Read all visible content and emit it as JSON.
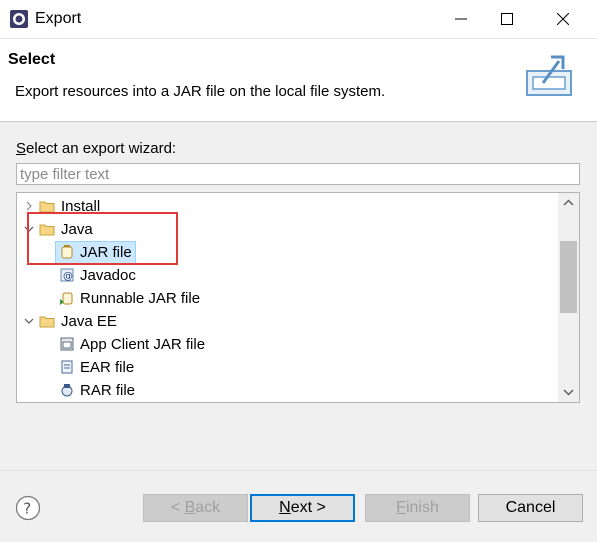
{
  "window": {
    "title": "Export"
  },
  "header": {
    "title": "Select",
    "description": "Export resources into a JAR file on the local file system."
  },
  "wizard": {
    "label_mnemonic": "S",
    "label_rest": "elect an export wizard:",
    "filter_placeholder": "type filter text",
    "filter_value": ""
  },
  "tree": {
    "items": [
      {
        "label": "Install",
        "type": "folder",
        "expanded": false,
        "icon": "folder-icon"
      },
      {
        "label": "Java",
        "type": "folder",
        "expanded": true,
        "icon": "folder-icon"
      },
      {
        "label": "JAR file",
        "type": "item",
        "selected": true,
        "icon": "jar-file-icon"
      },
      {
        "label": "Javadoc",
        "type": "item",
        "icon": "javadoc-icon"
      },
      {
        "label": "Runnable JAR file",
        "type": "item",
        "icon": "runnable-jar-icon"
      },
      {
        "label": "Java EE",
        "type": "folder",
        "expanded": true,
        "icon": "folder-icon"
      },
      {
        "label": "App Client JAR file",
        "type": "item",
        "icon": "app-client-jar-icon"
      },
      {
        "label": "EAR file",
        "type": "item",
        "icon": "ear-file-icon"
      },
      {
        "label": "RAR file",
        "type": "item",
        "icon": "rar-file-icon"
      }
    ]
  },
  "buttons": {
    "back_mnemonic": "B",
    "back_rest": "ack",
    "back_prefix": "< ",
    "next_mnemonic": "N",
    "next_rest": "ext >",
    "finish_mnemonic": "F",
    "finish_rest": "inish",
    "cancel": "Cancel"
  },
  "colors": {
    "selection": "#cce8ff",
    "highlight_annotation": "#e03a3a",
    "default_button_border": "#0078d7"
  }
}
